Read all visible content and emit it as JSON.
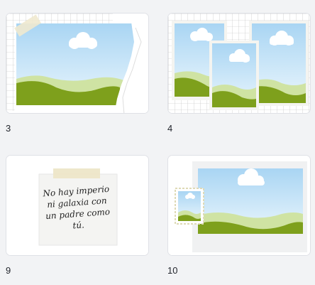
{
  "pages": [
    {
      "number": "3"
    },
    {
      "number": "4"
    },
    {
      "number": "9",
      "quote": "No hay imperio ni galaxia con un padre como tú."
    },
    {
      "number": "10"
    }
  ]
}
